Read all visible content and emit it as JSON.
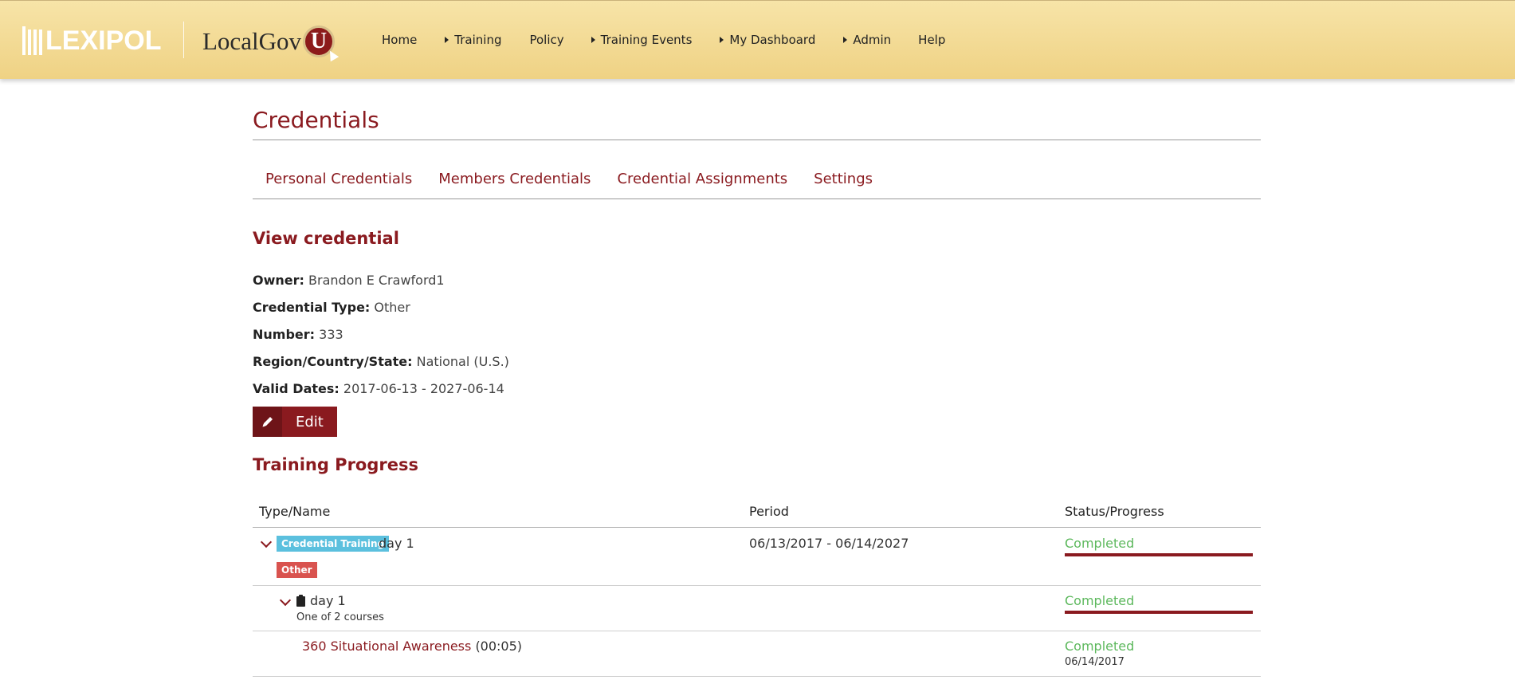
{
  "header": {
    "brand": "LEXIPOL",
    "product": "LocalGov",
    "product_badge": "U",
    "nav": [
      {
        "label": "Home",
        "has_caret": false
      },
      {
        "label": "Training",
        "has_caret": true
      },
      {
        "label": "Policy",
        "has_caret": false
      },
      {
        "label": "Training Events",
        "has_caret": true
      },
      {
        "label": "My Dashboard",
        "has_caret": true
      },
      {
        "label": "Admin",
        "has_caret": true
      },
      {
        "label": "Help",
        "has_caret": false
      }
    ]
  },
  "page": {
    "title": "Credentials",
    "tabs": [
      "Personal Credentials",
      "Members Credentials",
      "Credential Assignments",
      "Settings"
    ]
  },
  "view": {
    "heading": "View credential",
    "fields": [
      {
        "label": "Owner:",
        "value": "Brandon E Crawford1"
      },
      {
        "label": "Credential Type:",
        "value": "Other"
      },
      {
        "label": "Number:",
        "value": "333"
      },
      {
        "label": "Region/Country/State:",
        "value": "National (U.S.)"
      },
      {
        "label": "Valid Dates:",
        "value": "2017-06-13 - 2027-06-14"
      }
    ],
    "edit_label": "Edit"
  },
  "progress": {
    "heading": "Training Progress",
    "columns": [
      "Type/Name",
      "Period",
      "Status/Progress"
    ],
    "credential_row": {
      "tag": "Credential Training",
      "name": "day 1",
      "sub_tag": "Other",
      "period": "06/13/2017 - 06/14/2027",
      "status": "Completed",
      "progress": 1.0
    },
    "group_row": {
      "name": "day 1",
      "subtitle": "One of 2 courses",
      "status": "Completed",
      "progress": 1.0
    },
    "course_row": {
      "name": "360 Situational Awareness",
      "duration": "(00:05)",
      "status": "Completed",
      "date": "06/14/2017"
    }
  },
  "colors": {
    "accent": "#8a1a1f",
    "header_bg": "#f2d98f",
    "completed": "#5cb85c",
    "tag_blue": "#5bc0de",
    "tag_red": "#d9534f"
  }
}
